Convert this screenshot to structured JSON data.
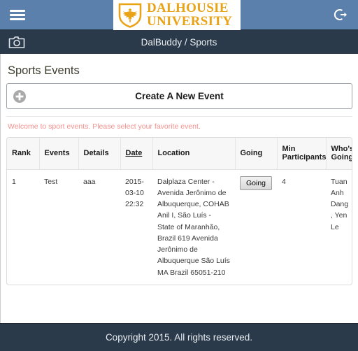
{
  "topbar": {
    "menu_icon": "hamburger-menu-icon",
    "logo_line1": "DALHOUSIE",
    "logo_line2": "UNIVERSITY",
    "logo_icon": "dalhousie-shield-icon",
    "logout_icon": "logout-icon"
  },
  "crumbbar": {
    "camera_icon": "camera-icon",
    "breadcrumb": "DalBuddy / Sports"
  },
  "main": {
    "page_title": "Sports Events",
    "create_button_label": "Create A New Event",
    "create_button_icon": "plus-circle-icon",
    "welcome_message": "Welcome to sport events. Please select your favorite event."
  },
  "table": {
    "columns": [
      "Rank",
      "Events",
      "Details",
      "Date",
      "Location",
      "Going",
      "Min Participants",
      "Who's Going"
    ],
    "sortable_column": "Date",
    "rows": [
      {
        "rank": "1",
        "events": "Test",
        "details": "aaa",
        "date": "2015-03-10 22:32",
        "location": "Dalplaza Center - Avenida Jerônimo de Albuquerque, COHAB Anil I, São Luís - State of Maranhão, Brazil 619 Avenida Jerônimo de Albuquerque São Luís MA Brazil 65051-210",
        "going_label": "Going",
        "min_participants": "4",
        "whos_going": "Tuan Anh Dang, Yen Le"
      }
    ]
  },
  "footer": {
    "copyright": "Copyright 2015. All rights reserved."
  },
  "colors": {
    "topbar_blue": "#5b80ac",
    "dark_navy": "#2b3a4a",
    "logo_gold": "#e8a317",
    "welcome_red": "#f5918e"
  }
}
